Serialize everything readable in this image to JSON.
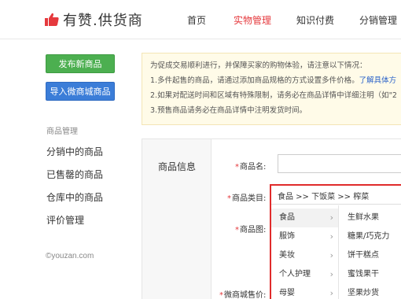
{
  "brand": {
    "logo_text": "有赞.供货商",
    "logo_icon": "thumbs-up-icon",
    "accent": "#e5393d"
  },
  "nav": {
    "items": [
      {
        "label": "首页",
        "active": false
      },
      {
        "label": "实物管理",
        "active": true
      },
      {
        "label": "知识付费",
        "active": false
      },
      {
        "label": "分销管理",
        "active": false
      }
    ]
  },
  "sidebar": {
    "publish_button": "发布新商品",
    "import_button": "导入微商城商品",
    "section_title": "商品管理",
    "items": [
      "分销中的商品",
      "已售罄的商品",
      "仓库中的商品",
      "评价管理"
    ],
    "copyright": "©youzan.com"
  },
  "notice": {
    "lines": [
      "为促成交易顺利进行，并保障买家的购物体验，请注意以下情况：",
      "1.多件起售的商品，请通过添加商品规格的方式设置多件价格。",
      "2.如果对配送时间和区域有特殊限制，请务必在商品详情中详细注明（如\"2",
      "3.预售商品请务必在商品详情中注明发货时间。"
    ],
    "link": "了解具体方"
  },
  "form": {
    "section_title": "商品信息",
    "name_label": "商品名:",
    "category_label": "商品类目:",
    "image_label": "商品图:",
    "price_label": "微商城售价:",
    "category_path": "食品 >> 下饭菜 >> 榨菜",
    "category_col1": [
      "食品",
      "服饰",
      "美妆",
      "个人护理",
      "母婴"
    ],
    "category_col2": [
      "生鲜水果",
      "糖果/巧克力",
      "饼干糕点",
      "蜜饯果干",
      "坚果炒货"
    ]
  }
}
